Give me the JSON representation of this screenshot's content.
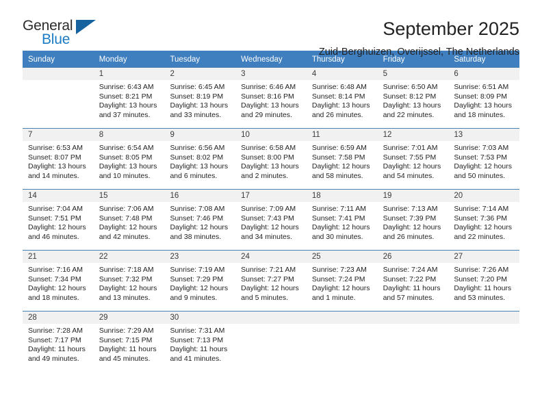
{
  "brand": {
    "name_top": "General",
    "name_bottom": "Blue",
    "accent_color": "#1b7bc4"
  },
  "header": {
    "title": "September 2025",
    "subtitle": "Zuid-Berghuizen, Overijssel, The Netherlands"
  },
  "theme": {
    "header_bg": "#3f7fbf",
    "day_band_bg": "#f1f1f1",
    "row_divider": "#4a81b5"
  },
  "weekdays": [
    "Sunday",
    "Monday",
    "Tuesday",
    "Wednesday",
    "Thursday",
    "Friday",
    "Saturday"
  ],
  "weeks": [
    [
      {
        "day": "",
        "sunrise": "",
        "sunset": "",
        "daylight_1": "",
        "daylight_2": ""
      },
      {
        "day": "1",
        "sunrise": "Sunrise: 6:43 AM",
        "sunset": "Sunset: 8:21 PM",
        "daylight_1": "Daylight: 13 hours",
        "daylight_2": "and 37 minutes."
      },
      {
        "day": "2",
        "sunrise": "Sunrise: 6:45 AM",
        "sunset": "Sunset: 8:19 PM",
        "daylight_1": "Daylight: 13 hours",
        "daylight_2": "and 33 minutes."
      },
      {
        "day": "3",
        "sunrise": "Sunrise: 6:46 AM",
        "sunset": "Sunset: 8:16 PM",
        "daylight_1": "Daylight: 13 hours",
        "daylight_2": "and 29 minutes."
      },
      {
        "day": "4",
        "sunrise": "Sunrise: 6:48 AM",
        "sunset": "Sunset: 8:14 PM",
        "daylight_1": "Daylight: 13 hours",
        "daylight_2": "and 26 minutes."
      },
      {
        "day": "5",
        "sunrise": "Sunrise: 6:50 AM",
        "sunset": "Sunset: 8:12 PM",
        "daylight_1": "Daylight: 13 hours",
        "daylight_2": "and 22 minutes."
      },
      {
        "day": "6",
        "sunrise": "Sunrise: 6:51 AM",
        "sunset": "Sunset: 8:09 PM",
        "daylight_1": "Daylight: 13 hours",
        "daylight_2": "and 18 minutes."
      }
    ],
    [
      {
        "day": "7",
        "sunrise": "Sunrise: 6:53 AM",
        "sunset": "Sunset: 8:07 PM",
        "daylight_1": "Daylight: 13 hours",
        "daylight_2": "and 14 minutes."
      },
      {
        "day": "8",
        "sunrise": "Sunrise: 6:54 AM",
        "sunset": "Sunset: 8:05 PM",
        "daylight_1": "Daylight: 13 hours",
        "daylight_2": "and 10 minutes."
      },
      {
        "day": "9",
        "sunrise": "Sunrise: 6:56 AM",
        "sunset": "Sunset: 8:02 PM",
        "daylight_1": "Daylight: 13 hours",
        "daylight_2": "and 6 minutes."
      },
      {
        "day": "10",
        "sunrise": "Sunrise: 6:58 AM",
        "sunset": "Sunset: 8:00 PM",
        "daylight_1": "Daylight: 13 hours",
        "daylight_2": "and 2 minutes."
      },
      {
        "day": "11",
        "sunrise": "Sunrise: 6:59 AM",
        "sunset": "Sunset: 7:58 PM",
        "daylight_1": "Daylight: 12 hours",
        "daylight_2": "and 58 minutes."
      },
      {
        "day": "12",
        "sunrise": "Sunrise: 7:01 AM",
        "sunset": "Sunset: 7:55 PM",
        "daylight_1": "Daylight: 12 hours",
        "daylight_2": "and 54 minutes."
      },
      {
        "day": "13",
        "sunrise": "Sunrise: 7:03 AM",
        "sunset": "Sunset: 7:53 PM",
        "daylight_1": "Daylight: 12 hours",
        "daylight_2": "and 50 minutes."
      }
    ],
    [
      {
        "day": "14",
        "sunrise": "Sunrise: 7:04 AM",
        "sunset": "Sunset: 7:51 PM",
        "daylight_1": "Daylight: 12 hours",
        "daylight_2": "and 46 minutes."
      },
      {
        "day": "15",
        "sunrise": "Sunrise: 7:06 AM",
        "sunset": "Sunset: 7:48 PM",
        "daylight_1": "Daylight: 12 hours",
        "daylight_2": "and 42 minutes."
      },
      {
        "day": "16",
        "sunrise": "Sunrise: 7:08 AM",
        "sunset": "Sunset: 7:46 PM",
        "daylight_1": "Daylight: 12 hours",
        "daylight_2": "and 38 minutes."
      },
      {
        "day": "17",
        "sunrise": "Sunrise: 7:09 AM",
        "sunset": "Sunset: 7:43 PM",
        "daylight_1": "Daylight: 12 hours",
        "daylight_2": "and 34 minutes."
      },
      {
        "day": "18",
        "sunrise": "Sunrise: 7:11 AM",
        "sunset": "Sunset: 7:41 PM",
        "daylight_1": "Daylight: 12 hours",
        "daylight_2": "and 30 minutes."
      },
      {
        "day": "19",
        "sunrise": "Sunrise: 7:13 AM",
        "sunset": "Sunset: 7:39 PM",
        "daylight_1": "Daylight: 12 hours",
        "daylight_2": "and 26 minutes."
      },
      {
        "day": "20",
        "sunrise": "Sunrise: 7:14 AM",
        "sunset": "Sunset: 7:36 PM",
        "daylight_1": "Daylight: 12 hours",
        "daylight_2": "and 22 minutes."
      }
    ],
    [
      {
        "day": "21",
        "sunrise": "Sunrise: 7:16 AM",
        "sunset": "Sunset: 7:34 PM",
        "daylight_1": "Daylight: 12 hours",
        "daylight_2": "and 18 minutes."
      },
      {
        "day": "22",
        "sunrise": "Sunrise: 7:18 AM",
        "sunset": "Sunset: 7:32 PM",
        "daylight_1": "Daylight: 12 hours",
        "daylight_2": "and 13 minutes."
      },
      {
        "day": "23",
        "sunrise": "Sunrise: 7:19 AM",
        "sunset": "Sunset: 7:29 PM",
        "daylight_1": "Daylight: 12 hours",
        "daylight_2": "and 9 minutes."
      },
      {
        "day": "24",
        "sunrise": "Sunrise: 7:21 AM",
        "sunset": "Sunset: 7:27 PM",
        "daylight_1": "Daylight: 12 hours",
        "daylight_2": "and 5 minutes."
      },
      {
        "day": "25",
        "sunrise": "Sunrise: 7:23 AM",
        "sunset": "Sunset: 7:24 PM",
        "daylight_1": "Daylight: 12 hours",
        "daylight_2": "and 1 minute."
      },
      {
        "day": "26",
        "sunrise": "Sunrise: 7:24 AM",
        "sunset": "Sunset: 7:22 PM",
        "daylight_1": "Daylight: 11 hours",
        "daylight_2": "and 57 minutes."
      },
      {
        "day": "27",
        "sunrise": "Sunrise: 7:26 AM",
        "sunset": "Sunset: 7:20 PM",
        "daylight_1": "Daylight: 11 hours",
        "daylight_2": "and 53 minutes."
      }
    ],
    [
      {
        "day": "28",
        "sunrise": "Sunrise: 7:28 AM",
        "sunset": "Sunset: 7:17 PM",
        "daylight_1": "Daylight: 11 hours",
        "daylight_2": "and 49 minutes."
      },
      {
        "day": "29",
        "sunrise": "Sunrise: 7:29 AM",
        "sunset": "Sunset: 7:15 PM",
        "daylight_1": "Daylight: 11 hours",
        "daylight_2": "and 45 minutes."
      },
      {
        "day": "30",
        "sunrise": "Sunrise: 7:31 AM",
        "sunset": "Sunset: 7:13 PM",
        "daylight_1": "Daylight: 11 hours",
        "daylight_2": "and 41 minutes."
      },
      {
        "day": "",
        "sunrise": "",
        "sunset": "",
        "daylight_1": "",
        "daylight_2": ""
      },
      {
        "day": "",
        "sunrise": "",
        "sunset": "",
        "daylight_1": "",
        "daylight_2": ""
      },
      {
        "day": "",
        "sunrise": "",
        "sunset": "",
        "daylight_1": "",
        "daylight_2": ""
      },
      {
        "day": "",
        "sunrise": "",
        "sunset": "",
        "daylight_1": "",
        "daylight_2": ""
      }
    ]
  ]
}
